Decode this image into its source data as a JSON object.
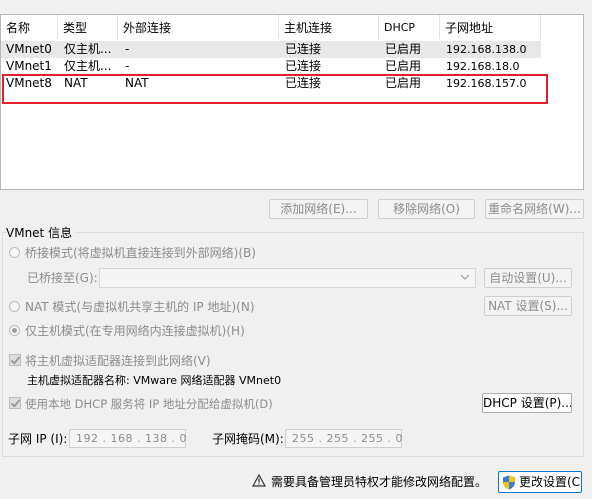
{
  "table": {
    "columns": [
      "名称",
      "类型",
      "外部连接",
      "主机连接",
      "DHCP",
      "子网地址"
    ],
    "rows": [
      [
        "VMnet0",
        "仅主机...",
        "-",
        "已连接",
        "已启用",
        "192.168.138.0"
      ],
      [
        "VMnet1",
        "仅主机...",
        "-",
        "已连接",
        "已启用",
        "192.168.18.0"
      ],
      [
        "VMnet8",
        "NAT",
        "NAT",
        "已连接",
        "已启用",
        "192.168.157.0"
      ]
    ]
  },
  "table_buttons": {
    "add": "添加网络(E)...",
    "remove": "移除网络(O)",
    "rename": "重命名网络(W)..."
  },
  "vmnet_info": {
    "title": "VMnet 信息",
    "bridged_label": "桥接模式(将虚拟机直接连接到外部网络)(B)",
    "bridged_to_label": "已桥接至(G):",
    "auto_settings": "自动设置(U)...",
    "nat_label": "NAT 模式(与虚拟机共享主机的 IP 地址)(N)",
    "nat_settings": "NAT 设置(S)...",
    "hostonly_label": "仅主机模式(在专用网络内连接虚拟机)(H)",
    "connect_adapter_label": "将主机虚拟适配器连接到此网络(V)",
    "adapter_name_label": "主机虚拟适配器名称: VMware 网络适配器 VMnet0",
    "dhcp_label": "使用本地 DHCP 服务将 IP 地址分配给虚拟机(D)",
    "dhcp_settings": "DHCP 设置(P)...",
    "subnet_ip_label": "子网 IP (I):",
    "subnet_ip_value": "192 . 168 . 138 . 0",
    "subnet_mask_label": "子网掩码(M):",
    "subnet_mask_value": "255 . 255 . 255 . 0"
  },
  "footer": {
    "warning": "需要具备管理员特权才能修改网络配置。",
    "change_settings": "更改设置(C)"
  },
  "colors": {
    "highlight_box": "#e3202a",
    "selected_row": "#e8e8e8",
    "disabled_text": "#8d8d8d"
  },
  "icons": {
    "warning": "warning-icon",
    "admin_shield": "shield-icon",
    "dropdown": "chevron-down-icon"
  }
}
